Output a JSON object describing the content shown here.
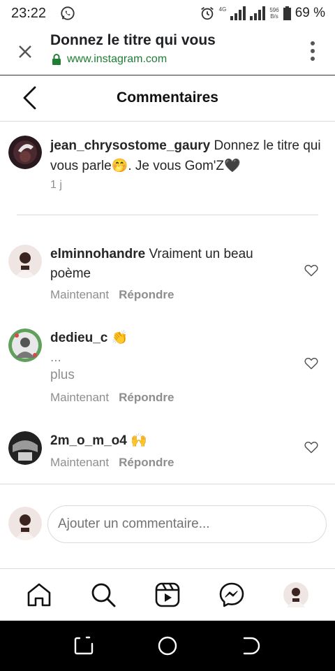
{
  "status_bar": {
    "time": "23:22",
    "network": "4G",
    "speed_value": "596",
    "speed_unit": "B/s",
    "battery": "69 %"
  },
  "browser": {
    "title": "Donnez le titre qui vous",
    "url": "www.instagram.com"
  },
  "header": {
    "title": "Commentaires"
  },
  "caption": {
    "username": "jean_chrysostome_gaury",
    "text": " Donnez le titre qui vous parle🤭. Je vous Gom'Z🖤",
    "time": "1 j"
  },
  "comments": [
    {
      "username": "elminnohandre",
      "text": " Vraiment un beau poème",
      "time": "Maintenant",
      "reply_label": "Répondre"
    },
    {
      "username": "dedieu_c",
      "text": " 👏",
      "ellipsis": "...",
      "more_label": "plus",
      "time": "Maintenant",
      "reply_label": "Répondre"
    },
    {
      "username": "2m_o_m_o4",
      "text": " 🙌",
      "time": "Maintenant",
      "reply_label": "Répondre"
    }
  ],
  "add_comment": {
    "placeholder": "Ajouter un commentaire..."
  },
  "icons": {
    "whatsapp": "whatsapp-icon",
    "alarm": "alarm-icon",
    "close": "close-icon",
    "lock": "lock-icon",
    "menu": "more-vert-icon",
    "back": "back-arrow-icon",
    "heart": "heart-outline-icon",
    "home": "home-icon",
    "search": "search-icon",
    "reels": "reels-icon",
    "messenger": "messenger-icon"
  },
  "colors": {
    "url_green": "#1e7e34",
    "secondary_text": "#8e8e8e",
    "divider": "#dbdbdb"
  }
}
